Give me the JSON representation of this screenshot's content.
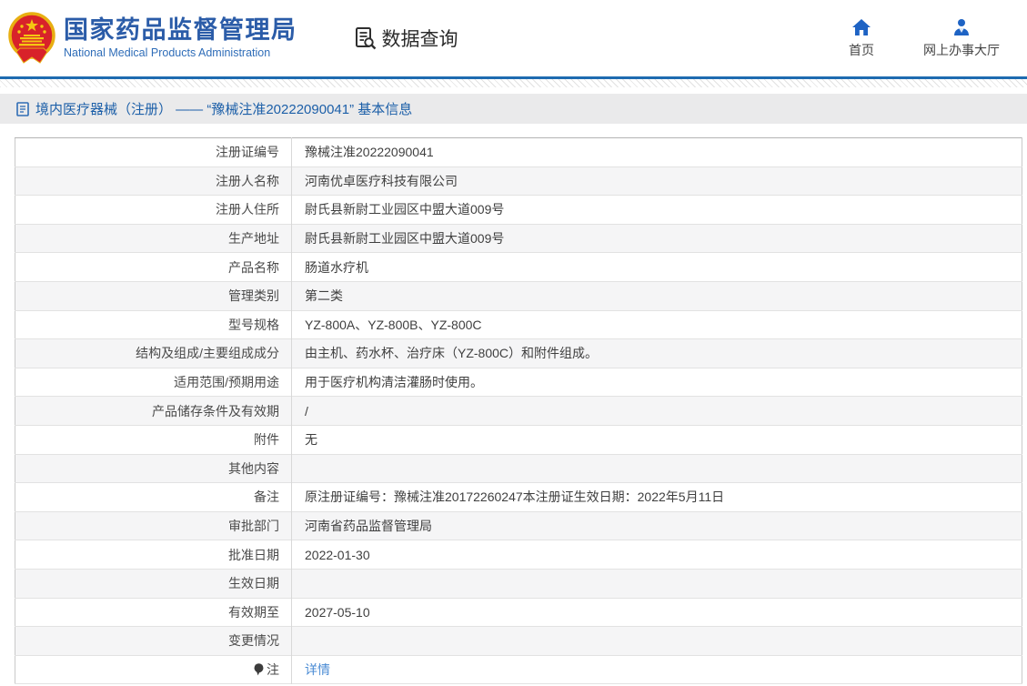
{
  "header": {
    "org_name_cn": "国家药品监督管理局",
    "org_name_en": "National Medical Products Administration",
    "data_query_label": "数据查询",
    "nav": [
      {
        "label": "首页",
        "icon": "home-icon"
      },
      {
        "label": "网上办事大厅",
        "icon": "person-icon"
      }
    ]
  },
  "breadcrumb": {
    "title": "境内医疗器械（注册） —— “豫械注准20222090041” 基本信息"
  },
  "table": {
    "rows": [
      {
        "label": "注册证编号",
        "value": "豫械注准20222090041"
      },
      {
        "label": "注册人名称",
        "value": "河南优卓医疗科技有限公司"
      },
      {
        "label": "注册人住所",
        "value": "尉氏县新尉工业园区中盟大道009号"
      },
      {
        "label": "生产地址",
        "value": "尉氏县新尉工业园区中盟大道009号"
      },
      {
        "label": "产品名称",
        "value": "肠道水疗机"
      },
      {
        "label": "管理类别",
        "value": "第二类"
      },
      {
        "label": "型号规格",
        "value": "YZ-800A、YZ-800B、YZ-800C"
      },
      {
        "label": "结构及组成/主要组成成分",
        "value": "由主机、药水杯、治疗床（YZ-800C）和附件组成。"
      },
      {
        "label": "适用范围/预期用途",
        "value": "用于医疗机构清洁灌肠时使用。"
      },
      {
        "label": "产品储存条件及有效期",
        "value": "/"
      },
      {
        "label": "附件",
        "value": "无"
      },
      {
        "label": "其他内容",
        "value": ""
      },
      {
        "label": "备注",
        "value": "原注册证编号：豫械注准20172260247本注册证生效日期：2022年5月11日"
      },
      {
        "label": "审批部门",
        "value": "河南省药品监督管理局"
      },
      {
        "label": "批准日期",
        "value": "2022-01-30"
      },
      {
        "label": "生效日期",
        "value": ""
      },
      {
        "label": "有效期至",
        "value": "2027-05-10"
      },
      {
        "label": "变更情况",
        "value": ""
      },
      {
        "label": "注",
        "value": "详情"
      }
    ]
  },
  "colors": {
    "accent_blue": "#2b5ca8",
    "nav_icon_blue": "#1e63c4",
    "divider_blue": "#1e6bb0",
    "link_blue": "#4a8bd4",
    "breadcrumb_bg": "#eaeaeb",
    "alt_row_bg": "#f5f5f6"
  }
}
